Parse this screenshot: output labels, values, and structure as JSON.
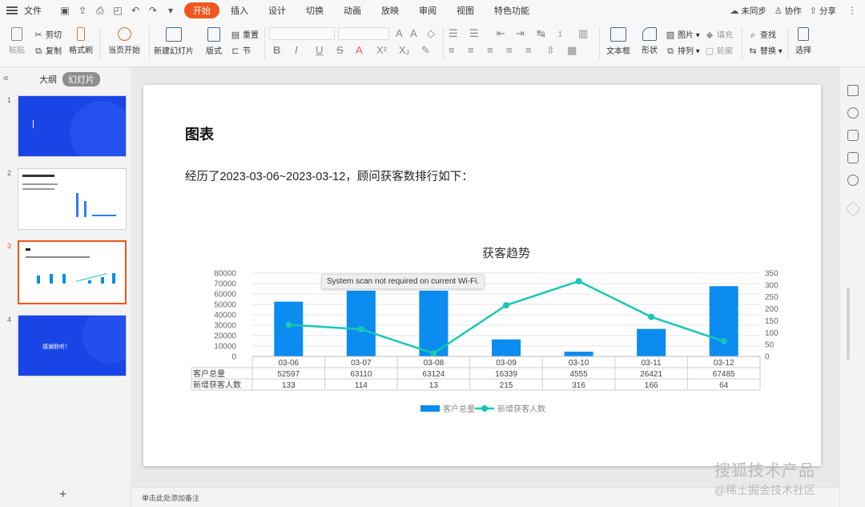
{
  "menubar": {
    "file_label": "文件",
    "tabs": [
      "开始",
      "插入",
      "设计",
      "切换",
      "动画",
      "放映",
      "审阅",
      "视图",
      "特色功能"
    ],
    "active_tab": "开始",
    "right": {
      "sync": "未同步",
      "collab": "协作",
      "share": "分享"
    }
  },
  "ribbon": {
    "paste": "粘贴",
    "cut": "剪切",
    "copy": "复制",
    "format_painter": "格式刷",
    "from_current": "当页开始",
    "new_slide": "新建幻灯片",
    "layout": "版式",
    "reset": "重置",
    "section": "节",
    "textbox": "文本框",
    "shape": "形状",
    "picture": "图片",
    "arrange": "排列",
    "fill": "填充",
    "outline": "轮廓",
    "find": "查找",
    "replace": "替换",
    "select": "选择"
  },
  "left_panel": {
    "tab_outline": "大纲",
    "tab_slides": "幻灯片",
    "slide_numbers": [
      "1",
      "2",
      "3",
      "4"
    ],
    "thumb4_text": "感谢聆听！",
    "selected_slide": 3
  },
  "slide": {
    "title": "图表",
    "body": "经历了2023-03-06~2023-03-12，顾问获客数排行如下："
  },
  "chart_data": {
    "type": "bar",
    "title": "获客趋势",
    "categories": [
      "03-06",
      "03-07",
      "03-08",
      "03-09",
      "03-10",
      "03-11",
      "03-12"
    ],
    "series": [
      {
        "name": "客户总量",
        "type": "bar",
        "axis": "left",
        "color": "#0a8cf0",
        "values": [
          52597,
          63110,
          63124,
          16339,
          4555,
          26421,
          67485
        ]
      },
      {
        "name": "新增获客人数",
        "type": "line",
        "axis": "right",
        "color": "#18c8b4",
        "values": [
          133,
          114,
          13,
          215,
          316,
          166,
          64
        ]
      }
    ],
    "left_axis": {
      "ticks": [
        "80000",
        "70000",
        "60000",
        "50000",
        "40000",
        "30000",
        "20000",
        "10000",
        "0"
      ],
      "ylim": [
        0,
        80000
      ]
    },
    "right_axis": {
      "ticks": [
        "350",
        "300",
        "250",
        "200",
        "150",
        "100",
        "50",
        "0"
      ],
      "ylim": [
        0,
        350
      ]
    },
    "table_row_labels": [
      "客户总量",
      "新增获客人数"
    ],
    "legend": [
      "客户总量",
      "新增获客人数"
    ],
    "legend_position": "bottom",
    "grid": true
  },
  "tooltip": "System scan not required on current Wi-Fi.",
  "notes_placeholder": "单击此处添加备注",
  "watermark": {
    "line1": "搜狐技术产品",
    "line2": "@稀土掘金技术社区"
  }
}
